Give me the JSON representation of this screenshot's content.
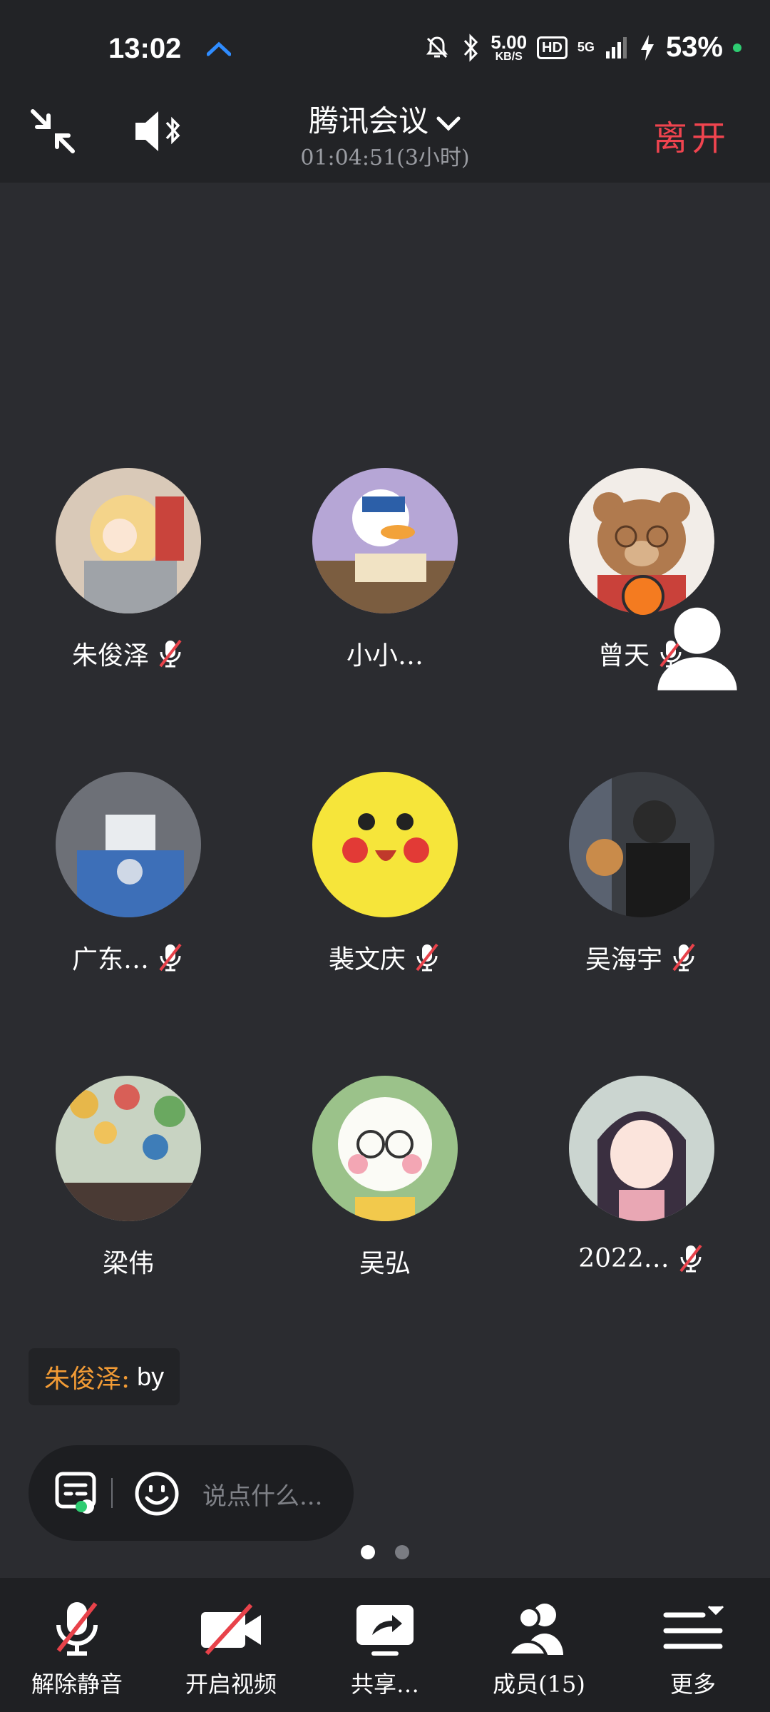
{
  "status_bar": {
    "time": "13:02",
    "net_speed_value": "5.00",
    "net_speed_unit": "KB/S",
    "hd": "HD",
    "network": "5G",
    "battery": "53%"
  },
  "header": {
    "title": "腾讯会议",
    "duration": "01:04:51(3小时)",
    "leave_label": "离开"
  },
  "participants": [
    {
      "name": "朱俊泽",
      "muted": true
    },
    {
      "name": "小小…",
      "muted": false
    },
    {
      "name": "曾天",
      "muted": true,
      "host": true
    },
    {
      "name": "广东…",
      "muted": true
    },
    {
      "name": "裴文庆",
      "muted": true
    },
    {
      "name": "吴海宇",
      "muted": true
    },
    {
      "name": "梁伟",
      "muted": false
    },
    {
      "name": "吴弘",
      "muted": false
    },
    {
      "name": "2022…",
      "muted": true
    }
  ],
  "chat": {
    "sender": "朱俊泽:",
    "message": "by"
  },
  "input": {
    "placeholder": "说点什么..."
  },
  "pager": {
    "pages": 2,
    "current": 1
  },
  "toolbar": {
    "unmute": "解除静音",
    "video": "开启视频",
    "share": "共享…",
    "members": "成员(15)",
    "more": "更多"
  },
  "colors": {
    "background": "#2b2c30",
    "leave": "#f0444f",
    "chat_sender": "#f29b35",
    "mute_slash": "#e8424a"
  }
}
